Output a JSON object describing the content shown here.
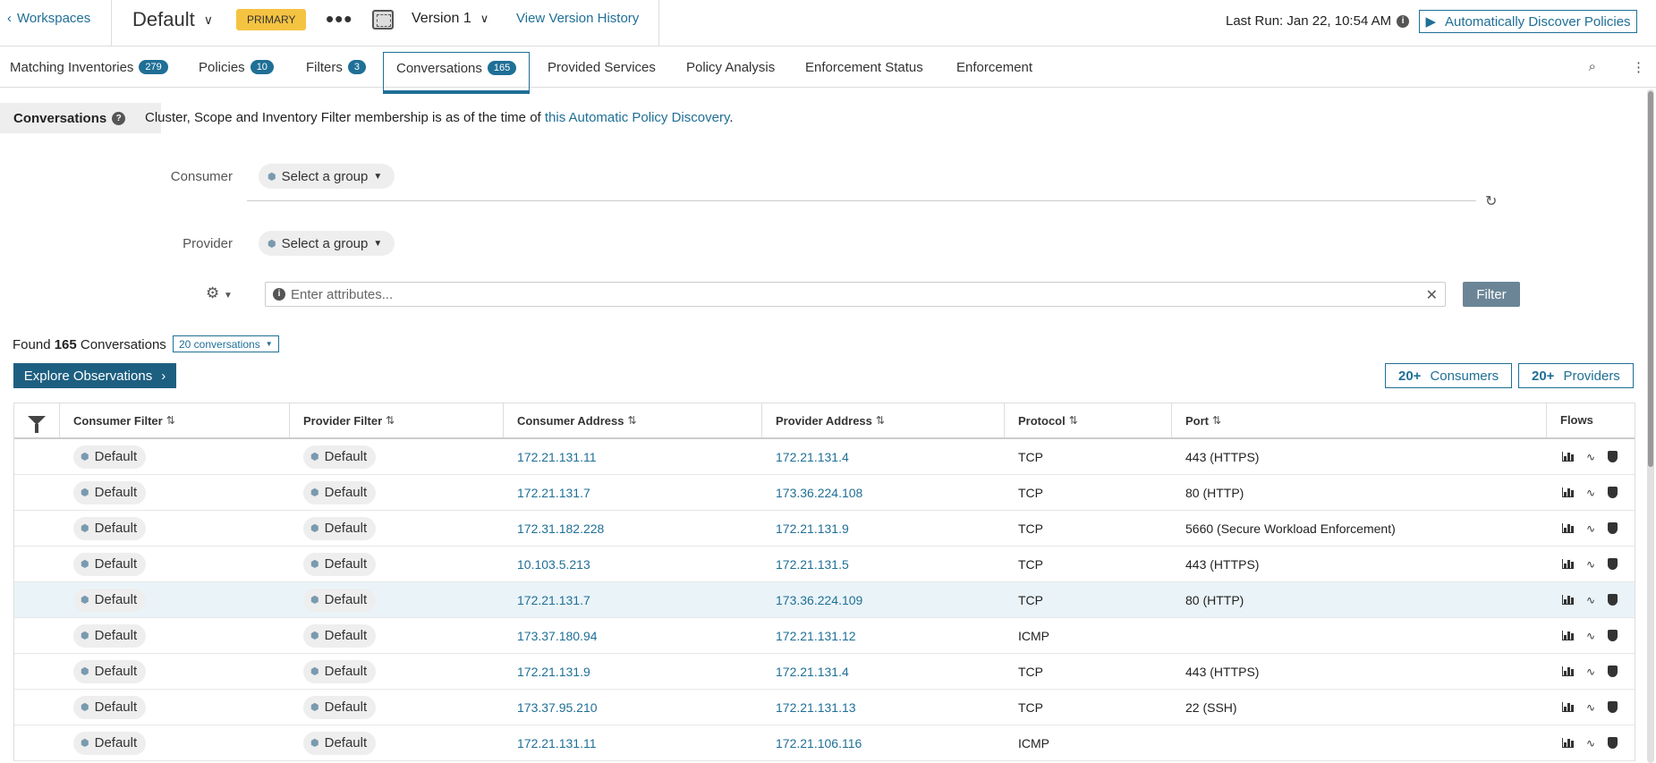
{
  "topbar": {
    "back_label": "Workspaces",
    "workspace_name": "Default",
    "badge": "PRIMARY",
    "version": "Version 1",
    "history_link": "View Version History",
    "last_run": "Last Run: Jan 22, 10:54 AM",
    "discover_button": "Automatically Discover Policies"
  },
  "tabs": [
    {
      "label": "Matching Inventories",
      "count": "279"
    },
    {
      "label": "Policies",
      "count": "10"
    },
    {
      "label": "Filters",
      "count": "3"
    },
    {
      "label": "Conversations",
      "count": "165"
    },
    {
      "label": "Provided Services"
    },
    {
      "label": "Policy Analysis"
    },
    {
      "label": "Enforcement Status"
    },
    {
      "label": "Enforcement"
    }
  ],
  "conversations": {
    "label": "Conversations",
    "desc_prefix": "Cluster, Scope and Inventory Filter membership is as of the time of ",
    "desc_link": "this Automatic Policy Discovery",
    "desc_suffix": "."
  },
  "filters": {
    "consumer_label": "Consumer",
    "provider_label": "Provider",
    "consumer_select": "Select a group",
    "provider_select": "Select a group",
    "attr_placeholder": "Enter attributes...",
    "filter_button": "Filter"
  },
  "results": {
    "found_prefix": "Found",
    "found_count": "165",
    "found_suffix": "Conversations",
    "page_size": "20 conversations",
    "explore_button": "Explore Observations",
    "consumers_count": "20+",
    "consumers_label": "Consumers",
    "providers_count": "20+",
    "providers_label": "Providers"
  },
  "table": {
    "headers": [
      "Consumer Filter",
      "Provider Filter",
      "Consumer Address",
      "Provider Address",
      "Protocol",
      "Port",
      "Flows"
    ],
    "rows": [
      {
        "consumer_filter": "Default",
        "provider_filter": "Default",
        "consumer_address": "172.21.131.11",
        "provider_address": "172.21.131.4",
        "protocol": "TCP",
        "port": "443 (HTTPS)"
      },
      {
        "consumer_filter": "Default",
        "provider_filter": "Default",
        "consumer_address": "172.21.131.7",
        "provider_address": "173.36.224.108",
        "protocol": "TCP",
        "port": "80 (HTTP)"
      },
      {
        "consumer_filter": "Default",
        "provider_filter": "Default",
        "consumer_address": "172.31.182.228",
        "provider_address": "172.21.131.9",
        "protocol": "TCP",
        "port": "5660 (Secure Workload Enforcement)"
      },
      {
        "consumer_filter": "Default",
        "provider_filter": "Default",
        "consumer_address": "10.103.5.213",
        "provider_address": "172.21.131.5",
        "protocol": "TCP",
        "port": "443 (HTTPS)"
      },
      {
        "consumer_filter": "Default",
        "provider_filter": "Default",
        "consumer_address": "172.21.131.7",
        "provider_address": "173.36.224.109",
        "protocol": "TCP",
        "port": "80 (HTTP)"
      },
      {
        "consumer_filter": "Default",
        "provider_filter": "Default",
        "consumer_address": "173.37.180.94",
        "provider_address": "172.21.131.12",
        "protocol": "ICMP",
        "port": ""
      },
      {
        "consumer_filter": "Default",
        "provider_filter": "Default",
        "consumer_address": "172.21.131.9",
        "provider_address": "172.21.131.4",
        "protocol": "TCP",
        "port": "443 (HTTPS)"
      },
      {
        "consumer_filter": "Default",
        "provider_filter": "Default",
        "consumer_address": "173.37.95.210",
        "provider_address": "172.21.131.13",
        "protocol": "TCP",
        "port": "22 (SSH)"
      },
      {
        "consumer_filter": "Default",
        "provider_filter": "Default",
        "consumer_address": "172.21.131.11",
        "provider_address": "172.21.106.116",
        "protocol": "ICMP",
        "port": ""
      }
    ]
  },
  "colors": {
    "accent": "#1f6f96",
    "badge": "#f5c342",
    "highlight_row": "#eaf4f8"
  }
}
